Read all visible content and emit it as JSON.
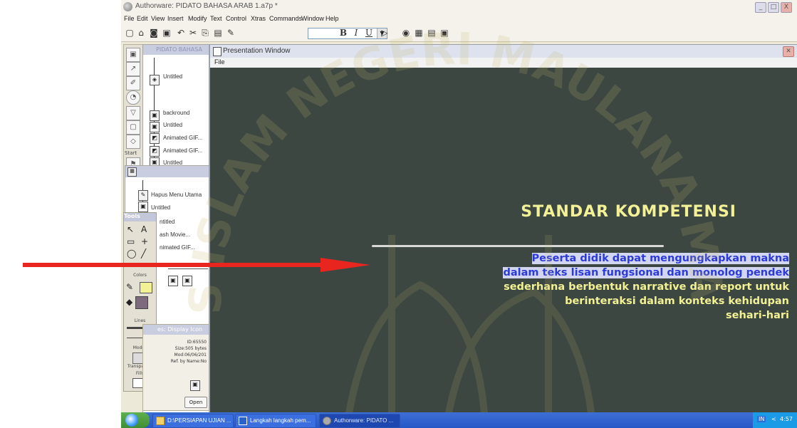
{
  "window": {
    "title": "Authorware: PIDATO BAHASA ARAB 1.a7p *",
    "controls": [
      "_",
      "□",
      "X"
    ]
  },
  "menu": [
    "File",
    "Edit",
    "View",
    "Insert",
    "Modify",
    "Text",
    "Control",
    "Xtras",
    "Commands",
    "Window",
    "Help"
  ],
  "toolbar": {
    "bold": "B",
    "italic": "I",
    "underline": "U"
  },
  "palette": {
    "start_label": "Start"
  },
  "flowline_panel": {
    "title": "PIDATO BAHASA",
    "items": [
      "Untitled",
      "backround",
      "Untitled",
      "Animated GIF...",
      "Animated GIF...",
      "Untitled"
    ]
  },
  "sub_flowline": {
    "items": [
      "Hapus Menu Utama",
      "Untitled",
      "ntitled",
      "ash Movie...",
      "nimated GIF..."
    ]
  },
  "tools_palette": {
    "title": "Tools",
    "colors_label": "Colors",
    "lines_label": "Lines",
    "modes_label": "Modes",
    "mode_value": "Transparent",
    "fills_label": "Fills"
  },
  "properties": {
    "title": "es: Display Icon",
    "id": "ID:65550",
    "size": "Size:505 bytes",
    "modified": "Mod:06/06/201",
    "ref": "Ref. by Name:No",
    "open_button": "Open"
  },
  "presentation": {
    "window_title": "Presentation Window",
    "file_menu": "File",
    "heading": "STANDAR KOMPETENSI",
    "selected_lines": [
      "Peserta didik dapat mengungkapkan makna",
      "dalam teks lisan fungsional dan monolog pendek"
    ],
    "lines": [
      "sederhana berbentuk narrative dan report untuk",
      "berinteraksi dalam konteks kehidupan",
      "sehari-hari"
    ]
  },
  "taskbar": {
    "tasks": [
      "D:\\PERSIAPAN UJIAN ...",
      "Langkah langkah pem...",
      "Authorware: PIDATO ..."
    ],
    "lang": "IN",
    "time": "4:57"
  },
  "watermark": {
    "text": "UNIVERSITAS ISLAM NEGERI MAULANA MALIK IBRAHIM"
  },
  "colors": {
    "heading": "#f3f195",
    "selection_text": "#2c3bd8",
    "selection_bg": "#d2d6f3",
    "stage_bg": "#3c4742",
    "arrow": "#e8261f"
  }
}
